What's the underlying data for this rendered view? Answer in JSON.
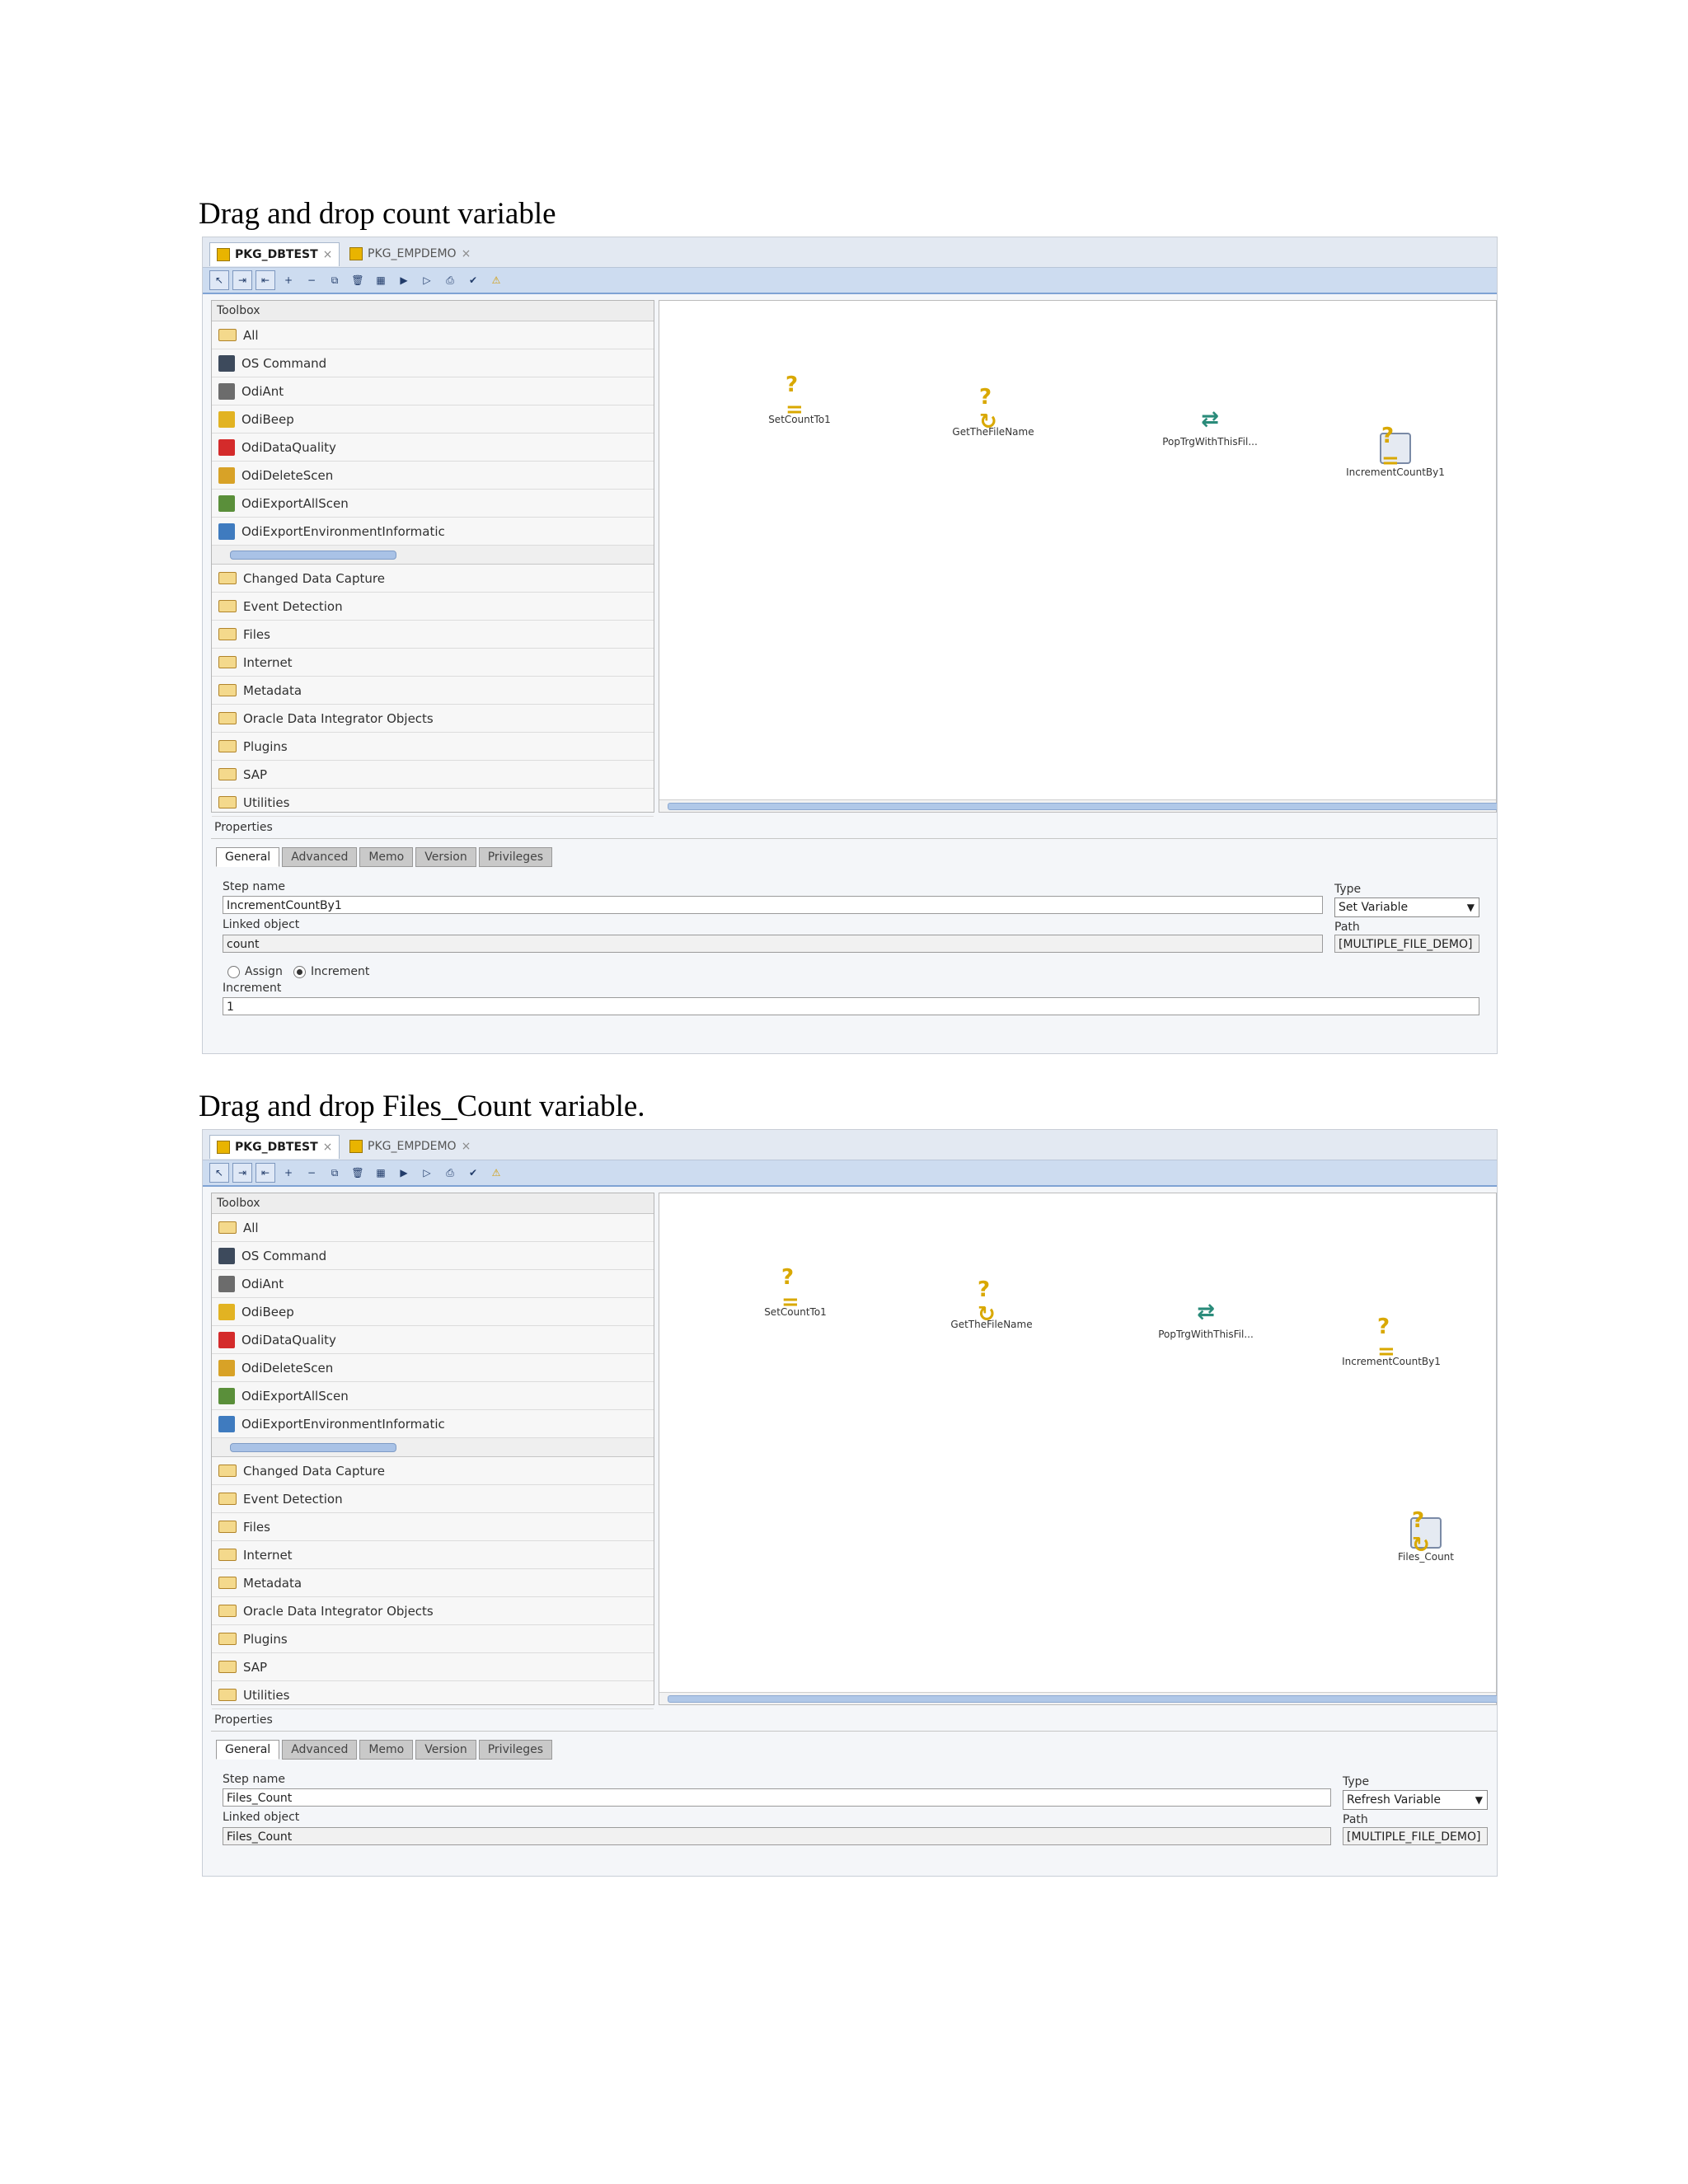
{
  "captions": [
    "Drag and drop count variable",
    "Drag and drop Files_Count variable."
  ],
  "editor_tabs": [
    "PKG_DBTEST",
    "PKG_EMPDEMO"
  ],
  "toolbox": {
    "title": "Toolbox",
    "all_label": "All",
    "tools": [
      "OS Command",
      "OdiAnt",
      "OdiBeep",
      "OdiDataQuality",
      "OdiDeleteScen",
      "OdiExportAllScen",
      "OdiExportEnvironmentInformatic"
    ],
    "folders": [
      "Changed Data Capture",
      "Event Detection",
      "Files",
      "Internet",
      "Metadata",
      "Oracle Data Integrator Objects",
      "Plugins",
      "SAP",
      "Utilities"
    ]
  },
  "properties": {
    "title": "Properties",
    "tabs": [
      "General",
      "Advanced",
      "Memo",
      "Version",
      "Privileges"
    ],
    "step_name_label": "Step name",
    "linked_object_label": "Linked object",
    "type_label": "Type",
    "path_label": "Path"
  },
  "shot1": {
    "nodes": [
      "SetCountTo1",
      "GetTheFileName",
      "PopTrgWithThisFil...",
      "IncrementCountBy1"
    ],
    "step_name": "IncrementCountBy1",
    "linked_object": "count",
    "type": "Set Variable",
    "path": "[MULTIPLE_FILE_DEMO]",
    "assign_label": "Assign",
    "increment_radio_label": "Increment",
    "increment_label": "Increment",
    "increment_value": "1"
  },
  "shot2": {
    "nodes": [
      "SetCountTo1",
      "GetTheFileName",
      "PopTrgWithThisFil...",
      "IncrementCountBy1",
      "Files_Count"
    ],
    "step_name": "Files_Count",
    "linked_object": "Files_Count",
    "type": "Refresh Variable",
    "path": "[MULTIPLE_FILE_DEMO]"
  }
}
